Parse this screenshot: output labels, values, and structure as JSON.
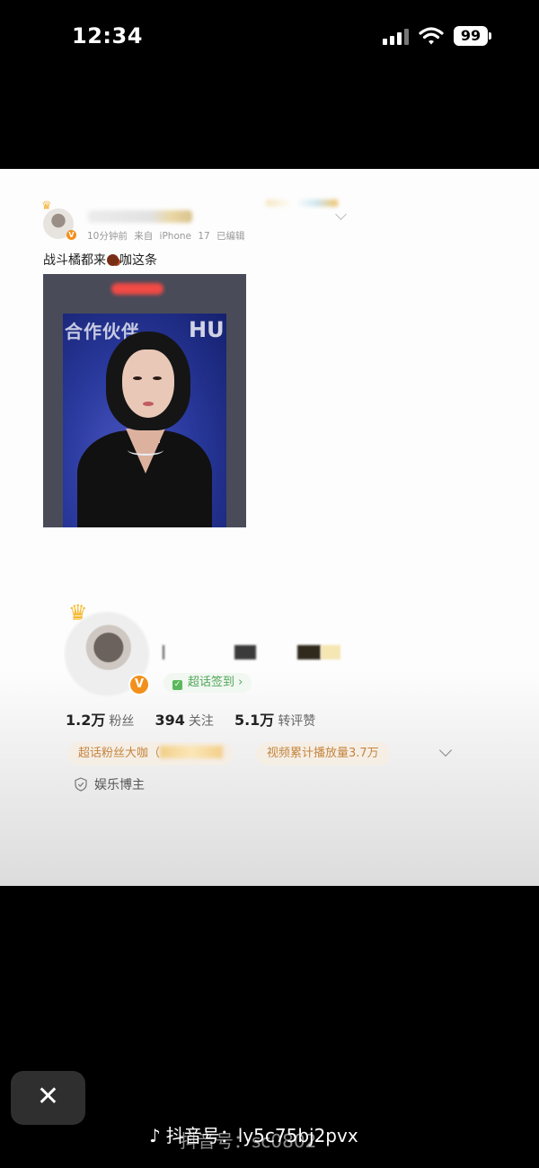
{
  "status_bar": {
    "time": "12:34",
    "battery": "99",
    "icons": [
      "signal-icon",
      "wifi-icon",
      "battery-icon"
    ]
  },
  "post": {
    "meta": "10分钟前 来自 iPhone 17 已编辑",
    "text_before": "战斗橘都来",
    "text_after": "咖这条",
    "emoji": "coffee-bean-icon"
  },
  "image": {
    "backdrop_text": "合作伙伴",
    "backdrop_text2": "HU"
  },
  "profile": {
    "checkin_label": "超话签到 ›",
    "stats": [
      {
        "value": "1.2万",
        "label": "粉丝"
      },
      {
        "value": "394",
        "label": "关注"
      },
      {
        "value": "5.1万",
        "label": "转评赞"
      }
    ],
    "tag1": "超话粉丝大咖（",
    "tag2": "视频累计播放量3.7万",
    "verify": "娱乐博主"
  },
  "overlay": {
    "close": "✕",
    "watermark_brand": "抖音号",
    "watermark_id": "ly5c75bj2pvx",
    "watermark_ghost": "抖音号：sc0802"
  },
  "colors": {
    "accent_orange": "#f3901c",
    "tag_text": "#c5853e",
    "checkin_green": "#52a85a"
  }
}
